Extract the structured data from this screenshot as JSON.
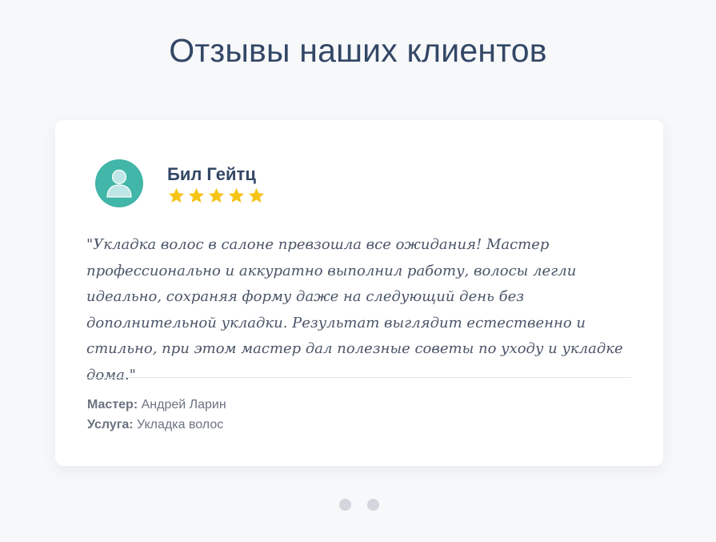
{
  "section": {
    "title": "Отзывы наших клиентов"
  },
  "review": {
    "author": "Бил Гейтц",
    "avatar_icon": "user-avatar-icon",
    "avatar_color": "#42b6a8",
    "rating": 5,
    "rating_max": 5,
    "star_color": "#f6c419",
    "text": "\"Укладка волос в салоне превзошла все ожидания! Мастер профессионально и аккуратно выполнил работу, волосы легли идеально, сохраняя форму даже на следующий день без дополнительной укладки. Результат выглядит естественно и стильно, при этом мастер дал полезные советы по уходу и укладке дома.\"",
    "master_label": "Мастер:",
    "master_value": "Андрей Ларин",
    "service_label": "Услуга:",
    "service_value": "Укладка волос"
  },
  "carousel": {
    "dot_count": 2,
    "dot_color": "#d3d6dd"
  },
  "colors": {
    "heading": "#334766",
    "background": "#f7f8fa"
  }
}
